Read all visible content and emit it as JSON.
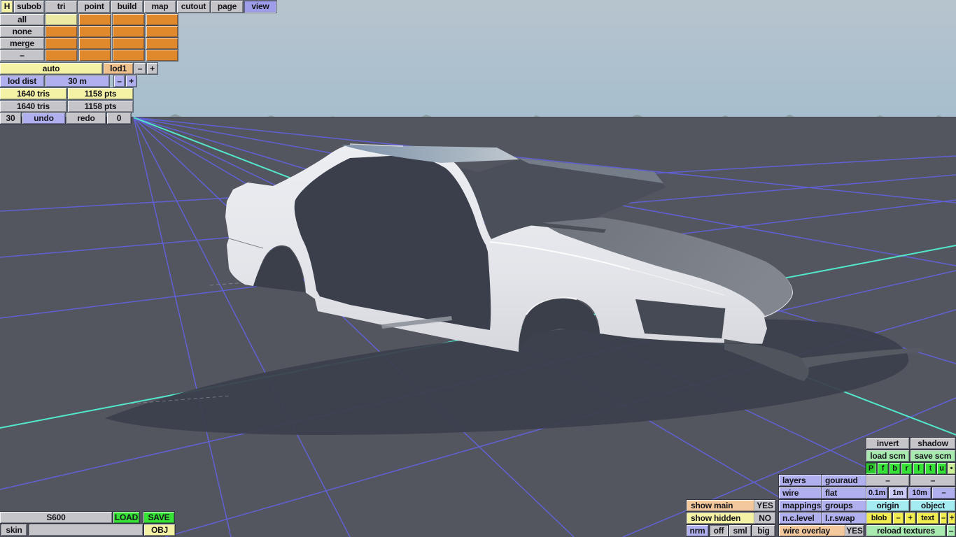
{
  "menu": {
    "items": [
      {
        "label": "H"
      },
      {
        "label": "subob"
      },
      {
        "label": "tri"
      },
      {
        "label": "point"
      },
      {
        "label": "build"
      },
      {
        "label": "map"
      },
      {
        "label": "cutout"
      },
      {
        "label": "page"
      },
      {
        "label": "view"
      }
    ],
    "active": "view"
  },
  "subobject_panel": {
    "buttons": {
      "all": "all",
      "none": "none",
      "merge": "merge",
      "dash": "–"
    },
    "grid_rows": 4,
    "grid_cols": 4,
    "selected_cell": "row 1 col 1"
  },
  "lod": {
    "auto": "auto",
    "level": "lod1",
    "minus": "–",
    "plus": "+",
    "dist_label": "lod dist",
    "dist_value": "30 m",
    "dist_minus": "–",
    "dist_plus": "+"
  },
  "stats": {
    "tris_selected": "1640 tris",
    "pts_selected": "1158 pts",
    "tris_total": "1640 tris",
    "pts_total": "1158 pts",
    "undo_steps": "30",
    "undo": "undo",
    "redo": "redo",
    "redo_steps": "0"
  },
  "file": {
    "model_name": "S600",
    "load": "LOAD",
    "save": "SAVE",
    "skin_label": "skin",
    "skin_value": "",
    "obj": "OBJ"
  },
  "view_panel": {
    "invert": "invert",
    "shadow": "shadow",
    "load_scm": "load scm",
    "save_scm": "save scm",
    "proj": [
      "P",
      "f",
      "b",
      "r",
      "l",
      "t",
      "u",
      "•"
    ],
    "layers": "layers",
    "gouraud": "gouraud",
    "dash_a": "–",
    "dash_b": "–",
    "wire": "wire",
    "flat": "flat",
    "grid_sizes": [
      "0.1m",
      "1m",
      "10m",
      "–"
    ],
    "grid_active": "1m",
    "show_main": "show main",
    "show_main_val": "YES",
    "mappings": "mappings",
    "groups": "groups",
    "origin": "origin",
    "object": "object",
    "show_hidden": "show hidden",
    "show_hidden_val": "NO",
    "nc_level": "n.c.level",
    "lr_swap": "l.r.swap",
    "blob": "blob",
    "blob_minus": "–",
    "blob_plus": "+",
    "text": "text",
    "text_minus": "–",
    "text_plus": "+",
    "nrm": "nrm",
    "nrm_modes": [
      "off",
      "sml",
      "big"
    ],
    "wire_overlay": "wire overlay",
    "wire_overlay_val": "YES",
    "reload_textures": "reload textures",
    "reload_dash": "–"
  },
  "scene": {
    "model": "white car body shell (S600 coupe), hood and roof shaded, door and window openings empty",
    "ground_grid": "perspective grid with two cyan axis lines crossing near front of car"
  },
  "colors": {
    "sky": "#aec0cd",
    "ground": "#54565f",
    "grid": "#6262e2",
    "axis": "#52e8cc",
    "car_body": "#e6e7eb",
    "car_hood": "#757981",
    "car_roof": "#8ea2b6",
    "shadow": "#3b404d",
    "orange": "#e0882c",
    "lavender": "#b0b0ee",
    "yellow": "#f4f2a4",
    "bright_yellow": "#f0ec50",
    "tan": "#eec08c",
    "grey": "#c5c5c9",
    "green": "#35e235",
    "pale_green": "#a8eab0",
    "cyan_btn": "#a5ecf2",
    "peach": "#f2c89c",
    "active_violet": "#9d9dea"
  }
}
